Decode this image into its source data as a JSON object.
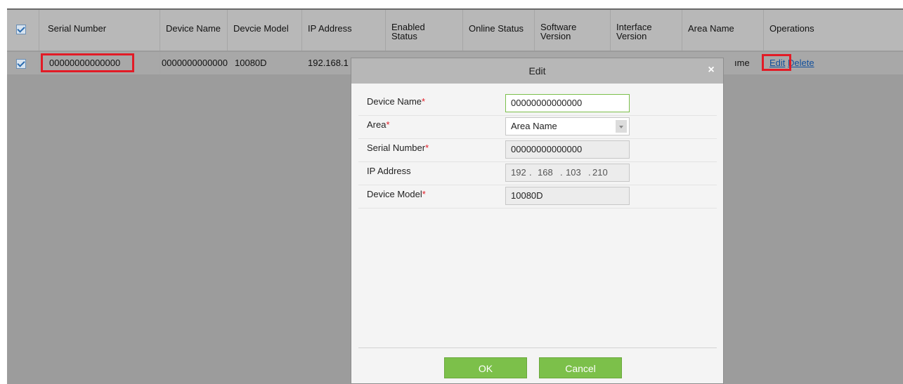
{
  "table": {
    "columns": [
      "Serial Number",
      "Device Name",
      "Devcie Model",
      "IP Address",
      "Enabled Status",
      "Online Status",
      "Software Version",
      "Interface Version",
      "Area Name",
      "Operations"
    ],
    "columns_split": {
      "enabled": [
        "Enabled",
        "Status"
      ],
      "software": [
        "Software",
        "Version"
      ],
      "interface": [
        "Interface",
        "Version"
      ]
    },
    "row": {
      "serial": "00000000000000",
      "device_name": "0000000000000",
      "model": "10080D",
      "ip": "192.168.1",
      "area_tail": "ıme",
      "edit": "Edit",
      "delete": "Delete"
    }
  },
  "dialog": {
    "title": "Edit",
    "close": "×",
    "fields": {
      "device_name": {
        "label": "Device Name",
        "value": "00000000000000"
      },
      "area": {
        "label": "Area",
        "value": "Area Name"
      },
      "serial": {
        "label": "Serial Number",
        "value": "00000000000000"
      },
      "ip": {
        "label": "IP Address",
        "octets": [
          "192",
          "168",
          "103",
          "210"
        ]
      },
      "model": {
        "label": "Device Model",
        "value": "10080D"
      }
    },
    "required_mark": "*",
    "ok": "OK",
    "cancel": "Cancel"
  },
  "colors": {
    "highlight": "#e21b26",
    "button": "#7cc04a",
    "link": "#114f9c"
  }
}
